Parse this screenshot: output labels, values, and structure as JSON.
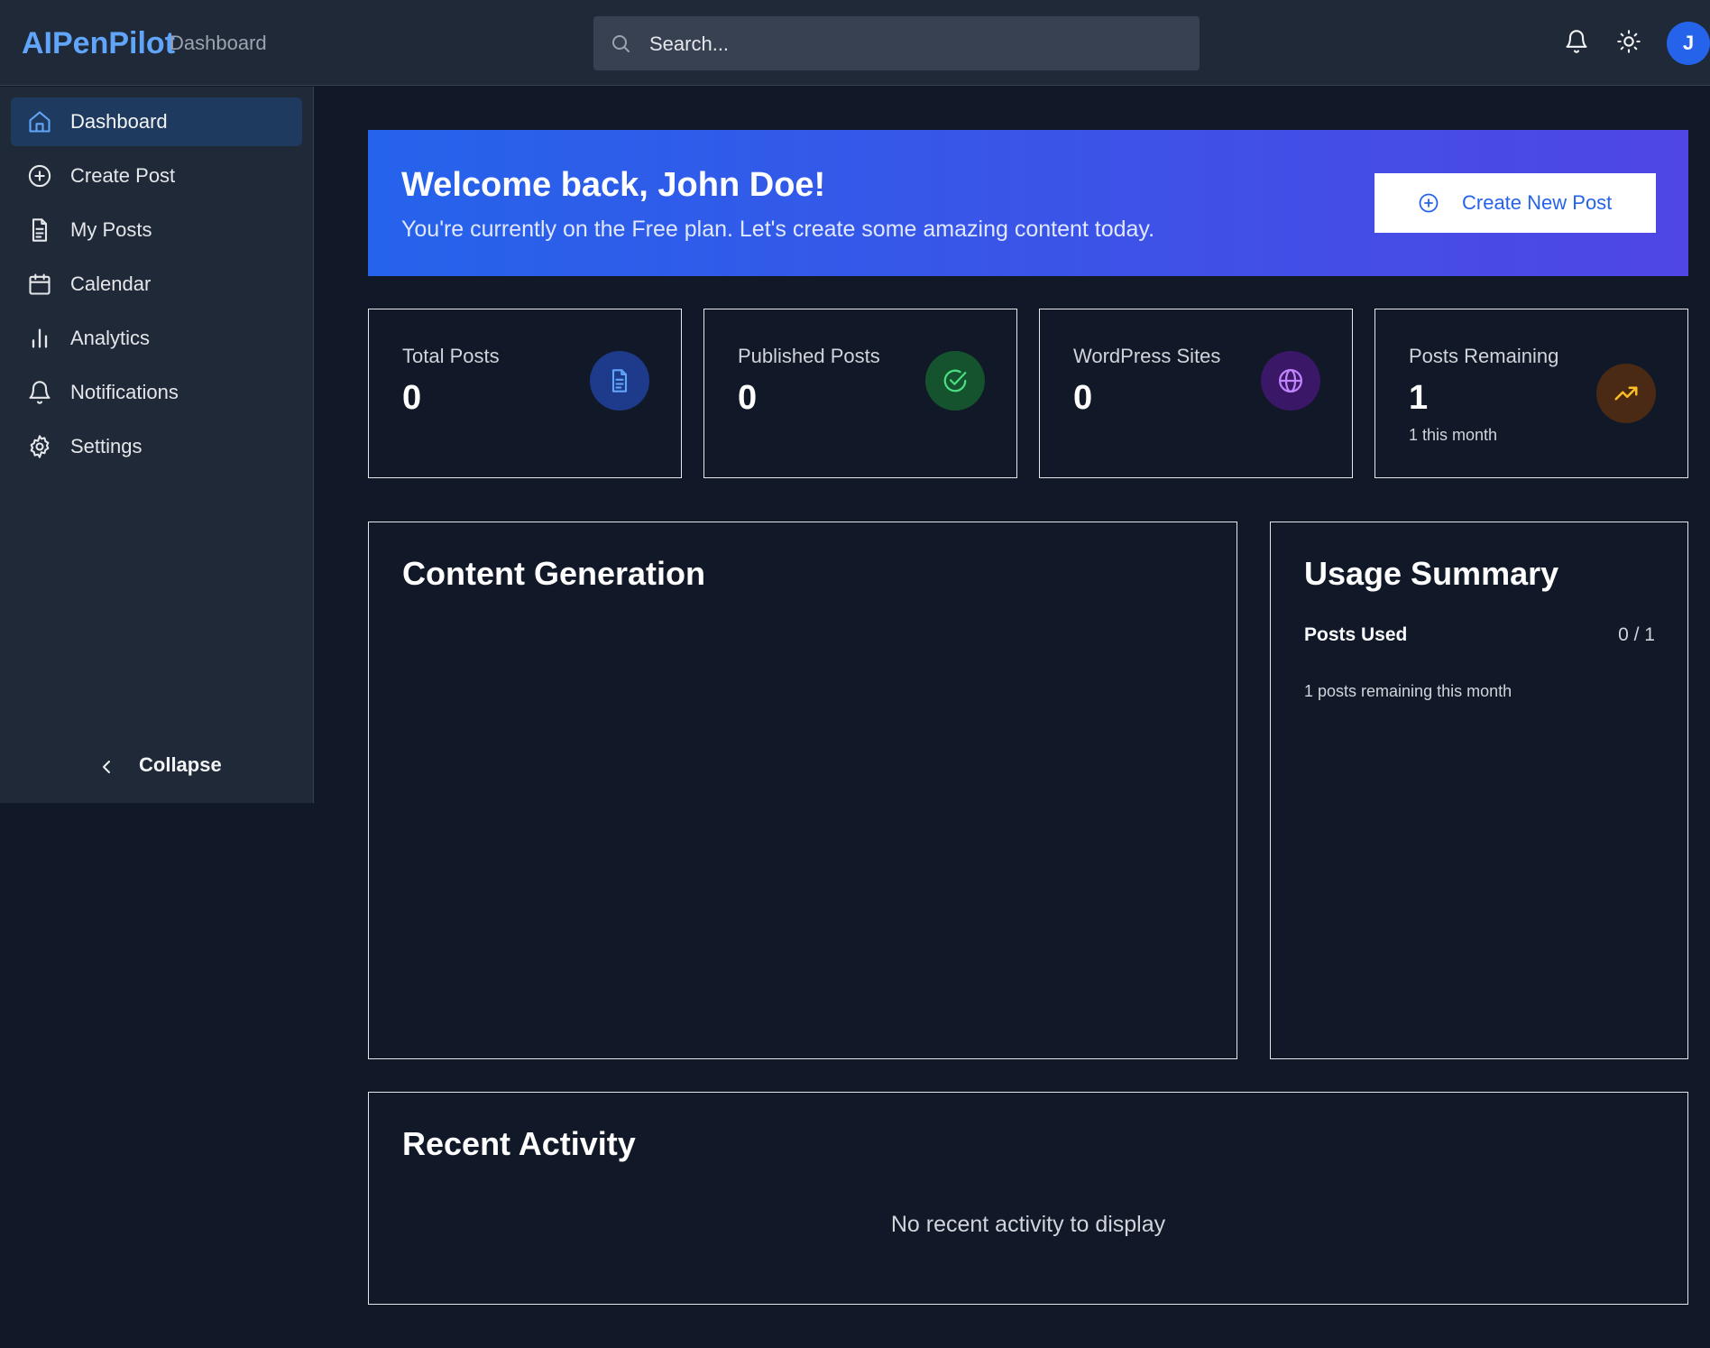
{
  "app": {
    "name": "AIPenPilot",
    "section": "Dashboard"
  },
  "search": {
    "placeholder": "Search..."
  },
  "user": {
    "initial": "J"
  },
  "sidebar": {
    "items": [
      {
        "label": "Dashboard",
        "icon": "home-icon",
        "active": true
      },
      {
        "label": "Create Post",
        "icon": "plus-circle-icon"
      },
      {
        "label": "My Posts",
        "icon": "file-text-icon"
      },
      {
        "label": "Calendar",
        "icon": "calendar-icon"
      },
      {
        "label": "Analytics",
        "icon": "bar-chart-icon"
      },
      {
        "label": "Notifications",
        "icon": "bell-icon"
      },
      {
        "label": "Settings",
        "icon": "gear-icon"
      }
    ],
    "collapse_label": "Collapse"
  },
  "welcome": {
    "title": "Welcome back, John Doe!",
    "message": "You're currently on the Free plan. Let's create some amazing content today.",
    "button_label": "Create New Post"
  },
  "stats": [
    {
      "label": "Total Posts",
      "value": "0",
      "icon": "file-text-icon",
      "color": "#60a5fa",
      "bg": "#1e3a8a"
    },
    {
      "label": "Published Posts",
      "value": "0",
      "icon": "check-circle-icon",
      "color": "#4ade80",
      "bg": "#14532d"
    },
    {
      "label": "WordPress Sites",
      "value": "0",
      "icon": "globe-icon",
      "color": "#c084fc",
      "bg": "#3b1768"
    },
    {
      "label": "Posts Remaining",
      "value": "1",
      "sub": "1 this month",
      "icon": "trending-up-icon",
      "color": "#fbbf24",
      "bg": "#4a2a14"
    }
  ],
  "content_generation": {
    "title": "Content Generation"
  },
  "usage": {
    "title": "Usage Summary",
    "posts_used_label": "Posts Used",
    "posts_used_value": "0 / 1",
    "note": "1 posts remaining this month"
  },
  "activity": {
    "title": "Recent Activity",
    "empty": "No recent activity to display"
  },
  "colors": {
    "accent": "#2563eb",
    "logo": "#60a5fa",
    "background": "#111827",
    "panel": "#1f2937"
  }
}
